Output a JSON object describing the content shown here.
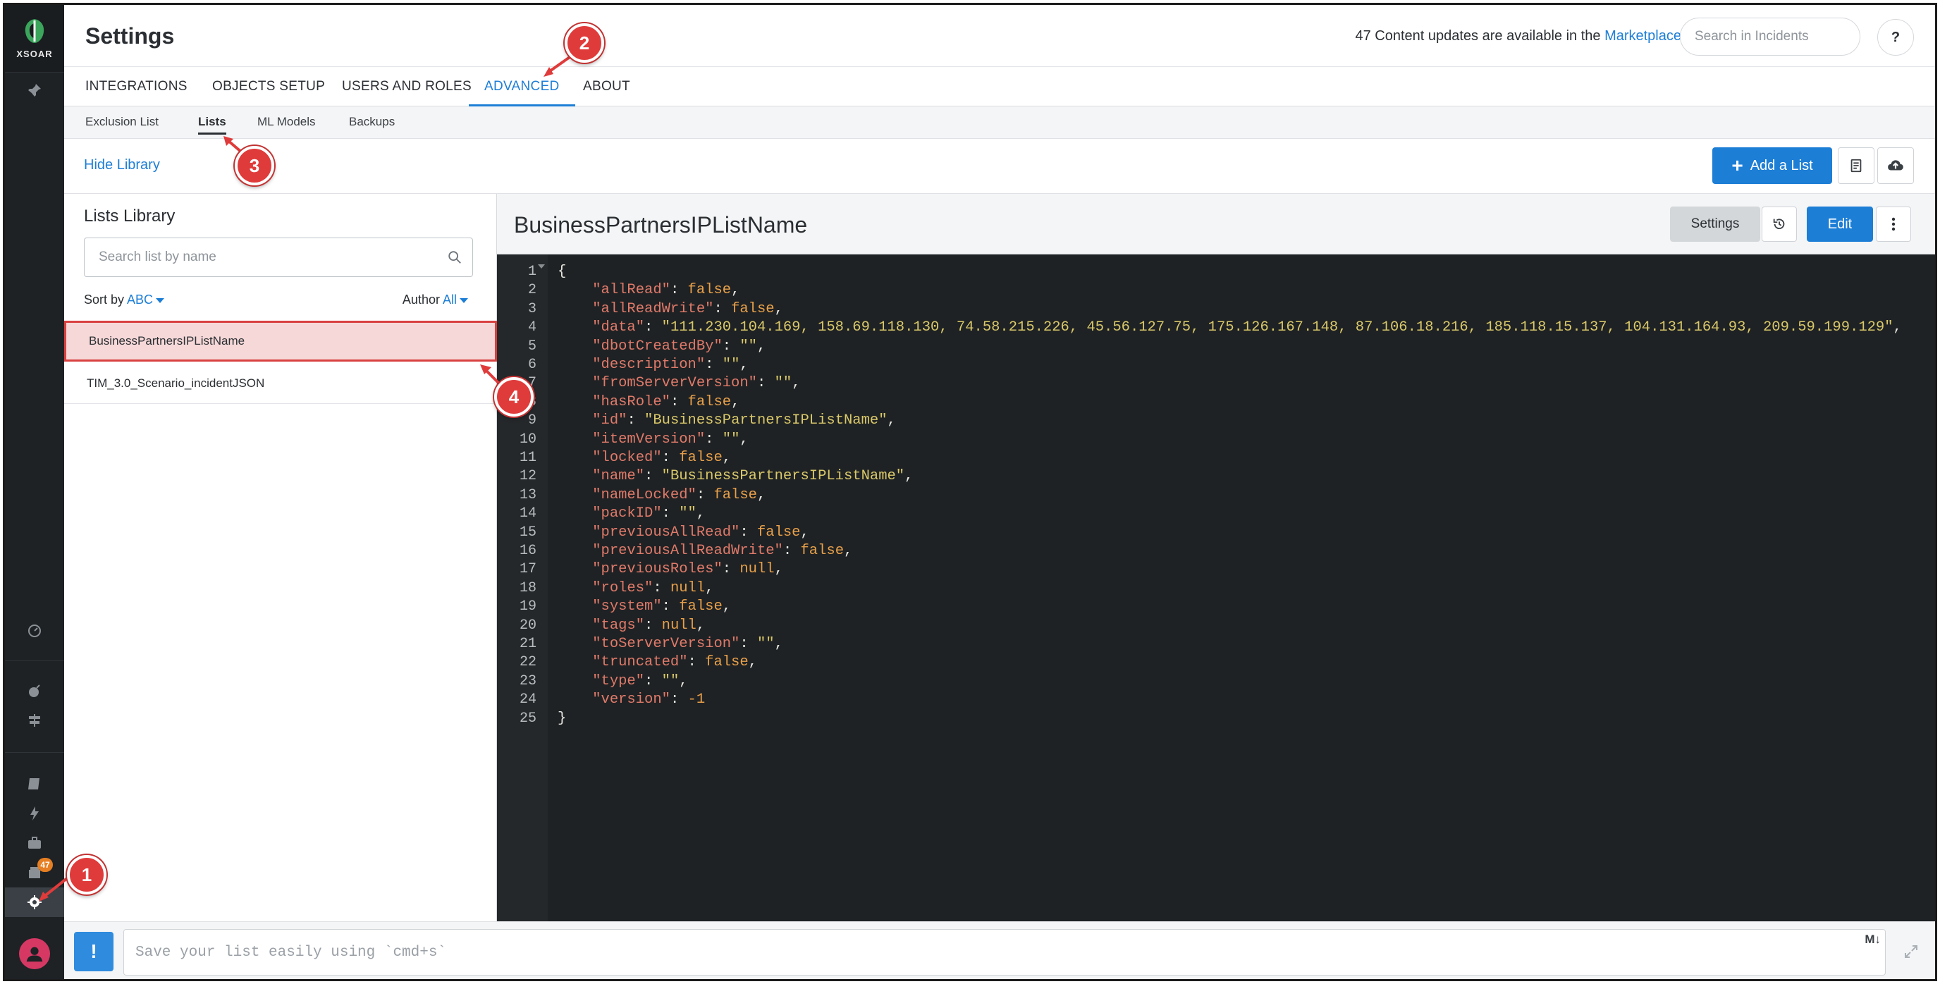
{
  "app": {
    "logo_text": "XSOAR",
    "page_title": "Settings"
  },
  "header": {
    "updates_text": "47 Content updates are available in the",
    "marketplace_link": "Marketplace",
    "search_placeholder": "Search in Incidents",
    "help_label": "?"
  },
  "tabs": [
    {
      "label": "INTEGRATIONS",
      "active": false
    },
    {
      "label": "OBJECTS SETUP",
      "active": false
    },
    {
      "label": "USERS AND ROLES",
      "active": false
    },
    {
      "label": "ADVANCED",
      "active": true
    },
    {
      "label": "ABOUT",
      "active": false
    }
  ],
  "subtabs": [
    {
      "label": "Exclusion List",
      "active": false
    },
    {
      "label": "Lists",
      "active": true
    },
    {
      "label": "ML Models",
      "active": false
    },
    {
      "label": "Backups",
      "active": false
    }
  ],
  "toolbar": {
    "hide_library": "Hide Library",
    "add_list": "Add a List"
  },
  "library": {
    "title": "Lists Library",
    "search_placeholder": "Search list by name",
    "sort_label": "Sort by",
    "sort_value": "ABC",
    "author_label": "Author",
    "author_value": "All",
    "items": [
      {
        "name": "BusinessPartnersIPListName",
        "selected": true
      },
      {
        "name": "TIM_3.0_Scenario_incidentJSON",
        "selected": false
      }
    ]
  },
  "editor": {
    "title": "BusinessPartnersIPListName",
    "settings_label": "Settings",
    "edit_label": "Edit",
    "lines": [
      "{",
      "    \"allRead\": false,",
      "    \"allReadWrite\": false,",
      "    \"data\": \"111.230.104.169, 158.69.118.130, 74.58.215.226, 45.56.127.75, 175.126.167.148, 87.106.18.216, 185.118.15.137, 104.131.164.93, 209.59.199.129\",",
      "    \"dbotCreatedBy\": \"\",",
      "    \"description\": \"\",",
      "    \"fromServerVersion\": \"\",",
      "    \"hasRole\": false,",
      "    \"id\": \"BusinessPartnersIPListName\",",
      "    \"itemVersion\": \"\",",
      "    \"locked\": false,",
      "    \"name\": \"BusinessPartnersIPListName\",",
      "    \"nameLocked\": false,",
      "    \"packID\": \"\",",
      "    \"previousAllRead\": false,",
      "    \"previousAllReadWrite\": false,",
      "    \"previousRoles\": null,",
      "    \"roles\": null,",
      "    \"system\": false,",
      "    \"tags\": null,",
      "    \"toServerVersion\": \"\",",
      "    \"truncated\": false,",
      "    \"type\": \"\",",
      "    \"version\": -1",
      "}"
    ]
  },
  "footer": {
    "placeholder": "Save your list easily using `cmd+s`",
    "md_label": "M↓"
  },
  "nav": {
    "badge_count": "47"
  },
  "markers": [
    "1",
    "2",
    "3",
    "4"
  ],
  "colors": {
    "accent": "#1d7ed6",
    "marker": "#e03b3b",
    "selected_bg": "#f6d8d8"
  }
}
